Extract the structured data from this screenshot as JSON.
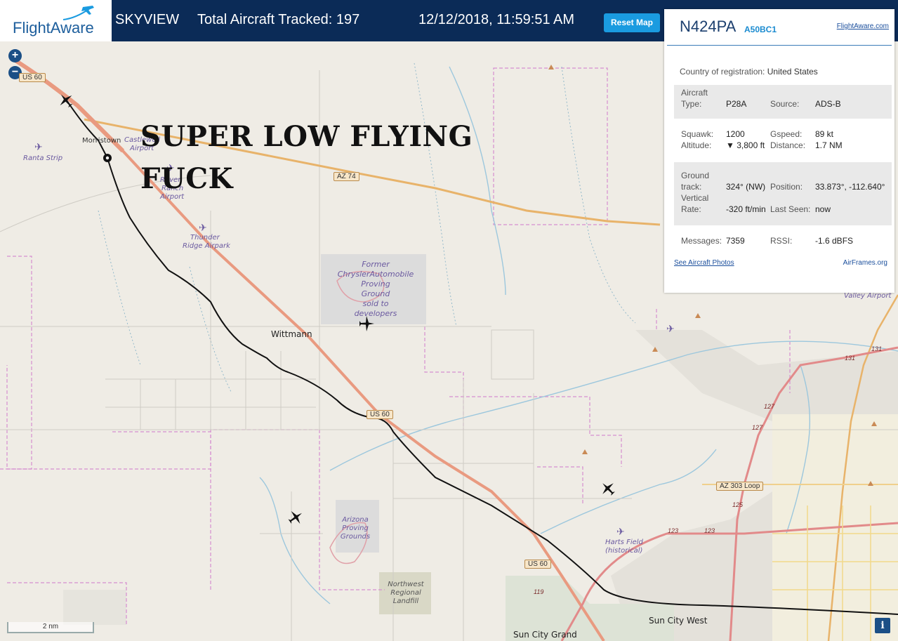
{
  "header": {
    "logo_text": "FlightAware",
    "app_title": "SKYVIEW",
    "tracked": "Total Aircraft Tracked: 197",
    "datetime": "12/12/2018, 11:59:51 AM",
    "reset_label": "Reset Map"
  },
  "caption": {
    "line1": "SUPER LOW FLYING",
    "line2": "FUCK"
  },
  "map": {
    "zoom_in": "+",
    "zoom_out": "−",
    "scale_label": "2 nm",
    "info_label": "i",
    "places": {
      "morristown": "Morristown",
      "wittmann": "Wittmann",
      "sun_city_west": "Sun City West",
      "sun_city_grand": "Sun City Grand"
    },
    "airports": {
      "ranta": "Ranta Strip",
      "castle_well_1": "Castlewell",
      "castle_well_2": "Airport",
      "rover_1": "Rover",
      "rover_2": "Ranch",
      "rover_3": "Airport",
      "thunder_1": "Thunder",
      "thunder_2": "Ridge Airpark",
      "valley": "Valley Airport",
      "harts_1": "Harts Field",
      "harts_2": "(historical)"
    },
    "areas": {
      "chrysler_1": "Former",
      "chrysler_2": "ChryslerAutomobile",
      "chrysler_3": "Proving",
      "chrysler_4": "Ground",
      "chrysler_5": "sold to",
      "chrysler_6": "developers",
      "arizona_1": "Arizona",
      "arizona_2": "Proving",
      "arizona_3": "Grounds",
      "landfill_1": "Northwest",
      "landfill_2": "Regional",
      "landfill_3": "Landfill"
    },
    "shields": {
      "us60_a": "US 60",
      "az74": "AZ 74",
      "us60_b": "US 60",
      "us60_c": "US 60",
      "az303": "AZ 303 Loop"
    },
    "route_numbers": {
      "r131a": "131",
      "r131b": "131",
      "r127a": "127",
      "r127b": "127",
      "r125": "125",
      "r123a": "123",
      "r123b": "123",
      "r119": "119"
    }
  },
  "panel": {
    "registration": "N424PA",
    "hex": "A50BC1",
    "fa_link": "FlightAware.com",
    "country_label": "Country of registration:",
    "country_value": "United States",
    "aircraft_type_label_1": "Aircraft",
    "aircraft_type_label_2": "Type:",
    "aircraft_type_value": "P28A",
    "source_label": "Source:",
    "source_value": "ADS-B",
    "squawk_label": "Squawk:",
    "squawk_value": "1200",
    "gspeed_label": "Gspeed:",
    "gspeed_value": "89 kt",
    "altitude_label": "Altitude:",
    "altitude_value": "▼ 3,800 ft",
    "distance_label": "Distance:",
    "distance_value": "1.7 NM",
    "track_label_1": "Ground",
    "track_label_2": "track:",
    "track_value": "324° (NW)",
    "position_label": "Position:",
    "position_value": "33.873°, -112.640°",
    "vrate_label_1": "Vertical",
    "vrate_label_2": "Rate:",
    "vrate_value": "-320 ft/min",
    "lastseen_label": "Last Seen:",
    "lastseen_value": "now",
    "messages_label": "Messages:",
    "messages_value": "7359",
    "rssi_label": "RSSI:",
    "rssi_value": "-1.6 dBFS",
    "photos_link": "See Aircraft Photos",
    "airframes_link": "AirFrames.org"
  }
}
